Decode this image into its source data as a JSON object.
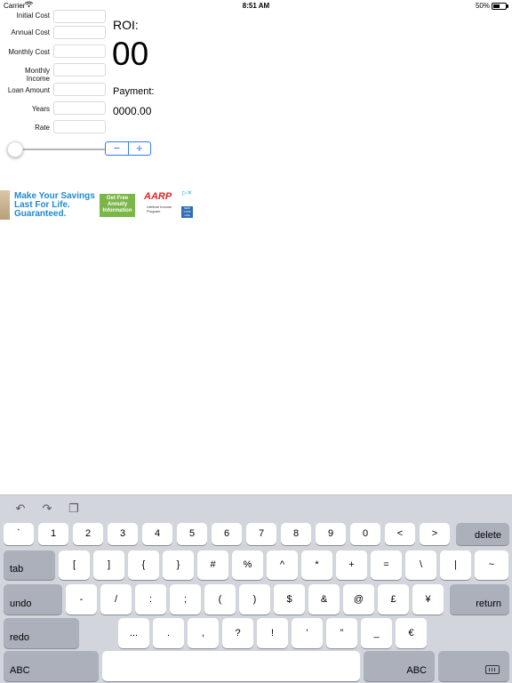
{
  "status_bar": {
    "carrier": "Carrier",
    "time": "8:51 AM",
    "battery_percent": "50%",
    "battery_level": 0.5
  },
  "form": {
    "fields": [
      {
        "label": "Initial Cost",
        "value": ""
      },
      {
        "label": "Annual Cost",
        "value": ""
      },
      {
        "label": "Monthly Cost",
        "value": ""
      },
      {
        "label": "Monthly Income",
        "value": ""
      },
      {
        "label": "Loan Amount",
        "value": ""
      },
      {
        "label": "Years",
        "value": ""
      },
      {
        "label": "Rate",
        "value": ""
      }
    ]
  },
  "results": {
    "roi_label": "ROI:",
    "roi_value": "00",
    "payment_label": "Payment:",
    "payment_value": "0000.00"
  },
  "controls": {
    "slider_value": 0,
    "stepper_minus": "−",
    "stepper_plus": "+"
  },
  "ad": {
    "headline": "Make Your Savings Last For Life. Guaranteed.",
    "cta": "Get Free Annuity Information",
    "brand": "AARP",
    "brand_sub": "Lifetime Income Program",
    "badge": "NEW YORK LIFE"
  },
  "keyboard": {
    "row1": [
      "`",
      "1",
      "2",
      "3",
      "4",
      "5",
      "6",
      "7",
      "8",
      "9",
      "0",
      "<",
      ">"
    ],
    "row1_fn": "delete",
    "row2_fn": "tab",
    "row2": [
      "[",
      "]",
      "{",
      "}",
      "#",
      "%",
      "^",
      "*",
      "+",
      "=",
      "\\",
      "|",
      "~"
    ],
    "row3_fn": "undo",
    "row3": [
      "-",
      "/",
      ":",
      ";",
      "(",
      ")",
      "$",
      "&",
      "@",
      "£",
      "¥"
    ],
    "row3_fn_right": "return",
    "row4_fn": "redo",
    "row4": [
      "...",
      ".",
      ",",
      "?",
      "!",
      "’",
      "”",
      "_",
      "€"
    ],
    "row5_left": "ABC",
    "row5_right": "ABC",
    "colors": {
      "background": "#d2d5dc",
      "key": "#ffffff",
      "function_key": "#abb0bb"
    },
    "tool_icons": [
      "undo-arrow-icon",
      "redo-arrow-icon",
      "paste-clipboard-icon"
    ],
    "dismiss_icon": "keyboard-dismiss-icon"
  },
  "colors": {
    "accent": "#2f7cf6",
    "ad_headline": "#1f8ad0",
    "ad_cta": "#7ab648",
    "aarp_red": "#e3231f"
  }
}
